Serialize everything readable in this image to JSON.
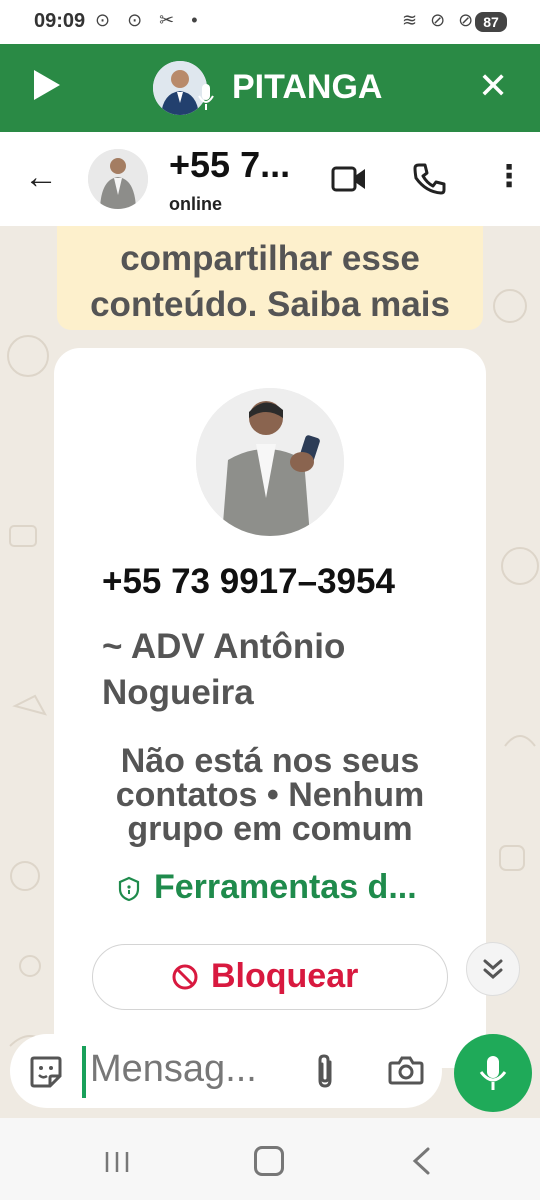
{
  "status_bar": {
    "time": "09:09",
    "left_icons": "⊙ ⊙ ✂ •",
    "right_icons": "≋ ⊘ ⊘",
    "battery": "87"
  },
  "overlay": {
    "title": "PITANGA",
    "play_icon": "play-icon",
    "close_icon": "close-icon",
    "close_glyph": "✕"
  },
  "header": {
    "back_glyph": "←",
    "contact_name": "+55 7...",
    "status": "online",
    "menu_glyph": "⋮"
  },
  "banner": {
    "line1": "compartilhar esse",
    "line2": "conteúdo. Saiba mais"
  },
  "contact_card": {
    "phone": "+55 73 9917–3954",
    "name": "~ ADV Antônio Nogueira",
    "info": "Não está nos seus contatos • Nenhum grupo em comum",
    "tools": "Ferramentas d...",
    "block_label": "Bloquear"
  },
  "input": {
    "placeholder": "Mensag..."
  },
  "colors": {
    "overlay_green": "#2a8a45",
    "accent_green": "#1faa59",
    "block_red": "#d8193f",
    "banner_bg": "#fdf0cc"
  }
}
